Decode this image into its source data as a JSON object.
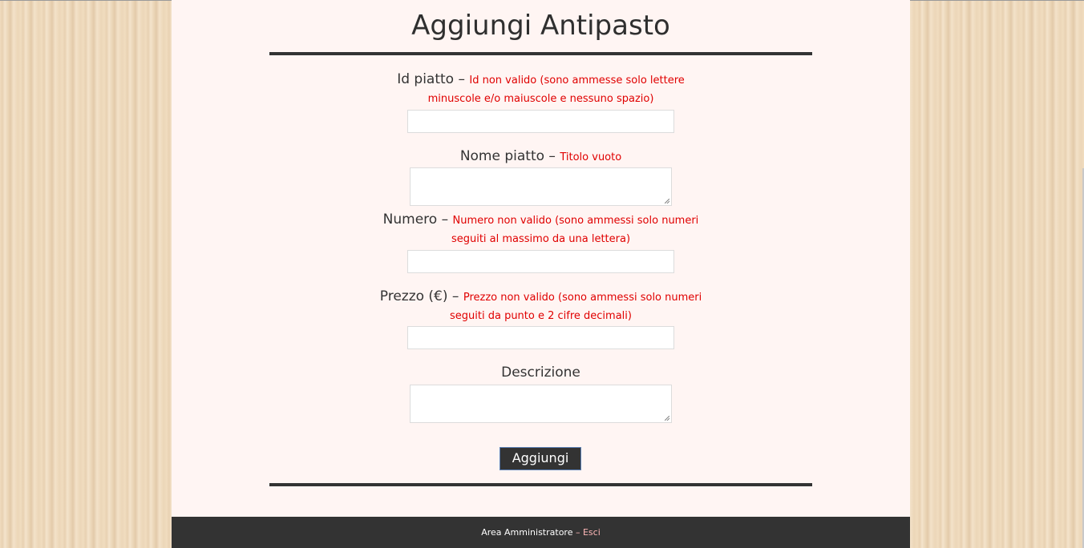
{
  "page": {
    "title": "Aggiungi Antipasto"
  },
  "form": {
    "fields": [
      {
        "label": "Id piatto",
        "dash": " – ",
        "error_line1": "Id non valido (sono ammesse solo lettere",
        "error_line2": "minuscole e/o maiuscole e nessuno spazio)",
        "value": ""
      },
      {
        "label": "Nome piatto",
        "dash": " – ",
        "error": "Titolo vuoto",
        "value": ""
      },
      {
        "label": "Numero",
        "dash": " – ",
        "error_line1": "Numero non valido (sono ammessi solo numeri",
        "error_line2": "seguiti al massimo da una lettera)",
        "value": ""
      },
      {
        "label": "Prezzo (€)",
        "dash": " – ",
        "error_line1": "Prezzo non valido (sono ammessi solo numeri",
        "error_line2": "seguiti da punto e 2 cifre decimali)",
        "value": ""
      },
      {
        "label": "Descrizione",
        "value": ""
      }
    ],
    "submit_label": "Aggiungi"
  },
  "footer": {
    "area_label": "Area Amministratore",
    "separator": " – ",
    "logout_label": "Esci"
  },
  "colors": {
    "error": "#e00000",
    "dark": "#333333",
    "page_bg": "#fff5f3"
  }
}
